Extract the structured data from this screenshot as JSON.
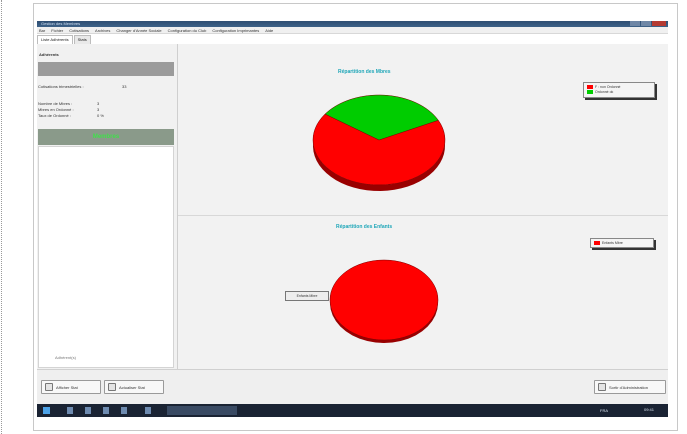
{
  "window": {
    "title": "Gestion des Membres"
  },
  "menu": [
    "Bar",
    "Fichier",
    "Cotisations",
    "Archives",
    "Changer d'Année Sociale",
    "Configuration du Club",
    "Configuration Imprimantes",
    "Aide"
  ],
  "tabs": [
    {
      "label": "Liste Adhérents",
      "active": true
    },
    {
      "label": "Stats",
      "active": false
    }
  ],
  "left_panel": {
    "header": "Adhérents",
    "count_label": "Cotisations trimestrielles :",
    "count_value": "33",
    "stats": [
      {
        "label": "Nombre de Mbres :",
        "value": "3"
      },
      {
        "label": "Mbres en Ordonné :",
        "value": "3"
      },
      {
        "label": "Taux de Ordonné :",
        "value": "0 %"
      }
    ],
    "section_title": "Membres",
    "footer": "Adhérent(s)"
  },
  "colors": {
    "red": "#ff0000",
    "green": "#00cc00",
    "title_teal": "#1ea6b8"
  },
  "chart_data": [
    {
      "type": "pie",
      "title": "Répartition des Mbres",
      "legend_position": "top-right",
      "series": [
        {
          "name": "F : non Ordonné",
          "value": 67,
          "color": "#ff0000"
        },
        {
          "name": "Ordonné ok",
          "value": 33,
          "color": "#00cc00"
        }
      ]
    },
    {
      "type": "pie",
      "title": "Répartition des Enfants",
      "legend_position": "top-right",
      "series": [
        {
          "name": "Enfants Mbre",
          "value": 100,
          "color": "#ff0000"
        }
      ]
    }
  ],
  "tooltip_label": "Enfants Mbre",
  "buttons": {
    "left1": "Afficher Stat",
    "left2": "Actualiser Stat",
    "right": "Sortir d'Administration"
  },
  "taskbar": {
    "tray": "FRA",
    "clock": "09:41"
  }
}
